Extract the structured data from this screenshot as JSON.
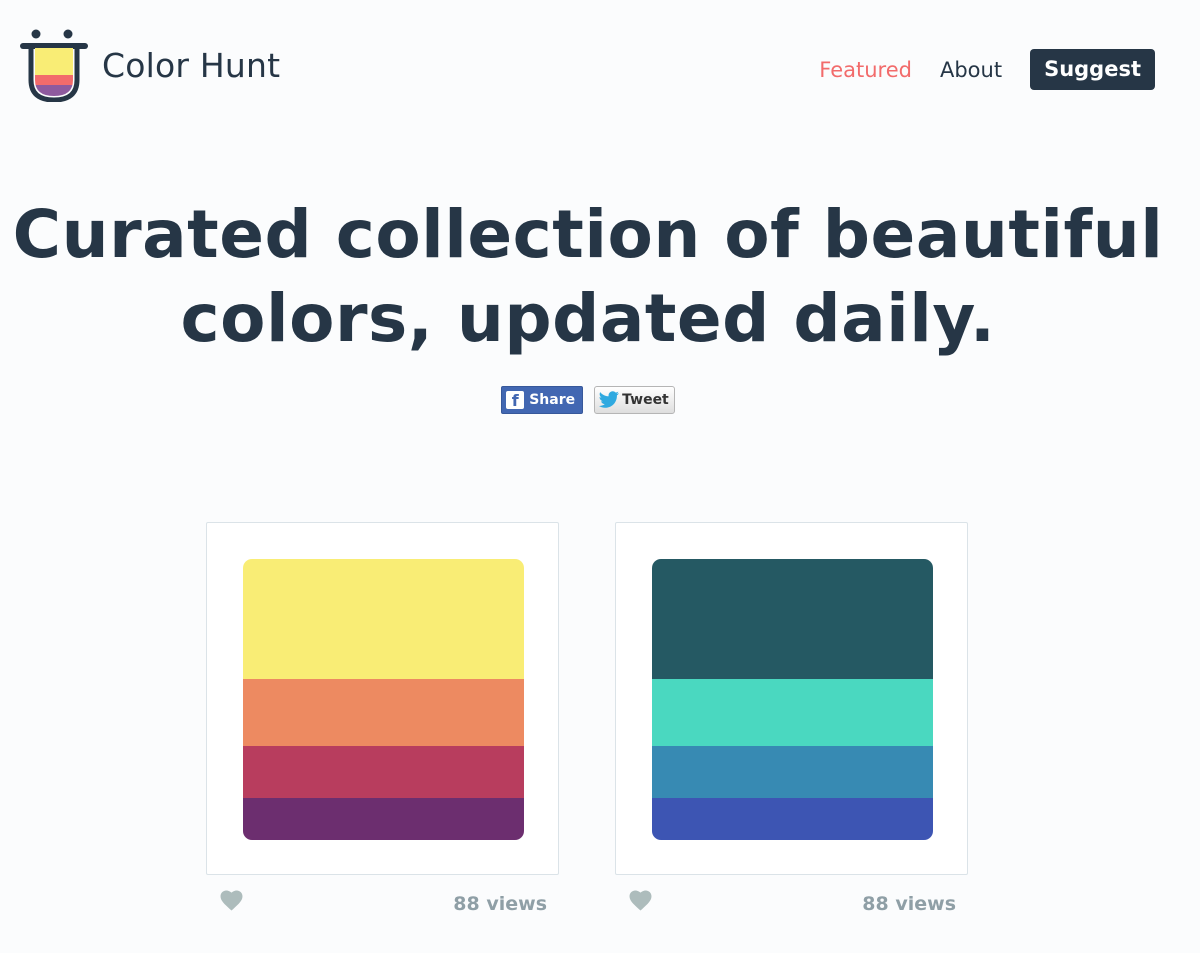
{
  "header": {
    "logo_text": "Color Hunt",
    "nav": {
      "featured": "Featured",
      "about": "About",
      "suggest": "Suggest"
    }
  },
  "hero": {
    "headline_line1": "Curated collection of beautiful",
    "headline_line2": "colors, updated daily.",
    "share_label": "Share",
    "tweet_label": "Tweet"
  },
  "palettes": [
    {
      "colors": [
        "#f9ed75",
        "#ed8a61",
        "#b83d5e",
        "#6c2e6f"
      ],
      "views": "88 views"
    },
    {
      "colors": [
        "#255963",
        "#4ad8c0",
        "#378ab3",
        "#3d55b3"
      ],
      "views": "88 views"
    }
  ],
  "colors": {
    "primary_text": "#263646",
    "accent": "#f26b6b",
    "heart": "#adbcbc"
  }
}
